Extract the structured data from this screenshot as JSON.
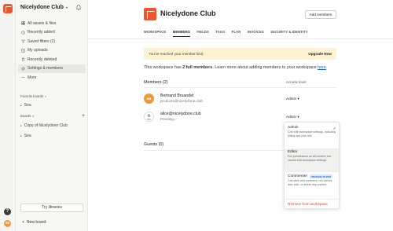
{
  "sidebar": {
    "workspace_name": "Nicelydone Club",
    "nav": [
      {
        "label": "All assets & files",
        "icon": "grid-icon"
      },
      {
        "label": "Recently added",
        "icon": "clock-icon"
      },
      {
        "label": "Saved filters (2)",
        "icon": "filter-icon"
      },
      {
        "label": "My uploads",
        "icon": "upload-icon"
      },
      {
        "label": "Recently deleted",
        "icon": "trash-icon"
      },
      {
        "label": "Settings & members",
        "icon": "gear-icon"
      },
      {
        "label": "More",
        "icon": "dots-icon"
      }
    ],
    "favorite_boards_label": "Favorite boards",
    "favorite_items": [
      "Sea"
    ],
    "boards_label": "Boards",
    "board_items": [
      "Copy of Nicelydone Club",
      "Sea"
    ],
    "try_libraries": "Try libraries",
    "new_board": "New board"
  },
  "rail": {
    "help": "?",
    "avatar_initials": "BB"
  },
  "header": {
    "title": "Nicelydone Club",
    "add_members": "Add members"
  },
  "tabs": [
    "WORKSPACE",
    "MEMBERS",
    "FIELDS",
    "TAGS",
    "PLAN",
    "INVOICES",
    "SECURITY & IDENTITY"
  ],
  "active_tab": "MEMBERS",
  "banner": {
    "text": "You've reached your member limit.",
    "link": "Upgrade Now"
  },
  "info": {
    "prefix": "This workspace has ",
    "count": "2 full members",
    "middle": ". Learn more about adding members to your workspace ",
    "link": "here",
    "suffix": "."
  },
  "members": {
    "heading": "Members (2)",
    "access_heading": "Access level",
    "list": [
      {
        "initials": "BB",
        "name": "Bertrand Bruandet",
        "sub": "products@nicelydone.club",
        "role": "Admin"
      },
      {
        "initials": "",
        "name": "alice@nicelydone.club",
        "sub": "Pending...",
        "role": "Admin"
      }
    ]
  },
  "guests": {
    "heading": "Guests (0)"
  },
  "menu": {
    "items": [
      {
        "title": "Admin",
        "desc": "Can edit workspace settings, including billing and plan info",
        "checked": true
      },
      {
        "title": "Editor",
        "desc": "Full permissions on all content, but cannot edit workspace settings"
      },
      {
        "title": "Commenter",
        "badge": "UPGRADE TO PRO",
        "desc": "Can view and comment, but cannot add, edit, or delete any content"
      }
    ],
    "remove": "Remove from workspace"
  },
  "colors": {
    "brand": "#f2542d",
    "banner_bg": "#fdf3d0",
    "link": "#2b5fd9",
    "danger": "#d94234",
    "avatar": "#e99a3b"
  }
}
